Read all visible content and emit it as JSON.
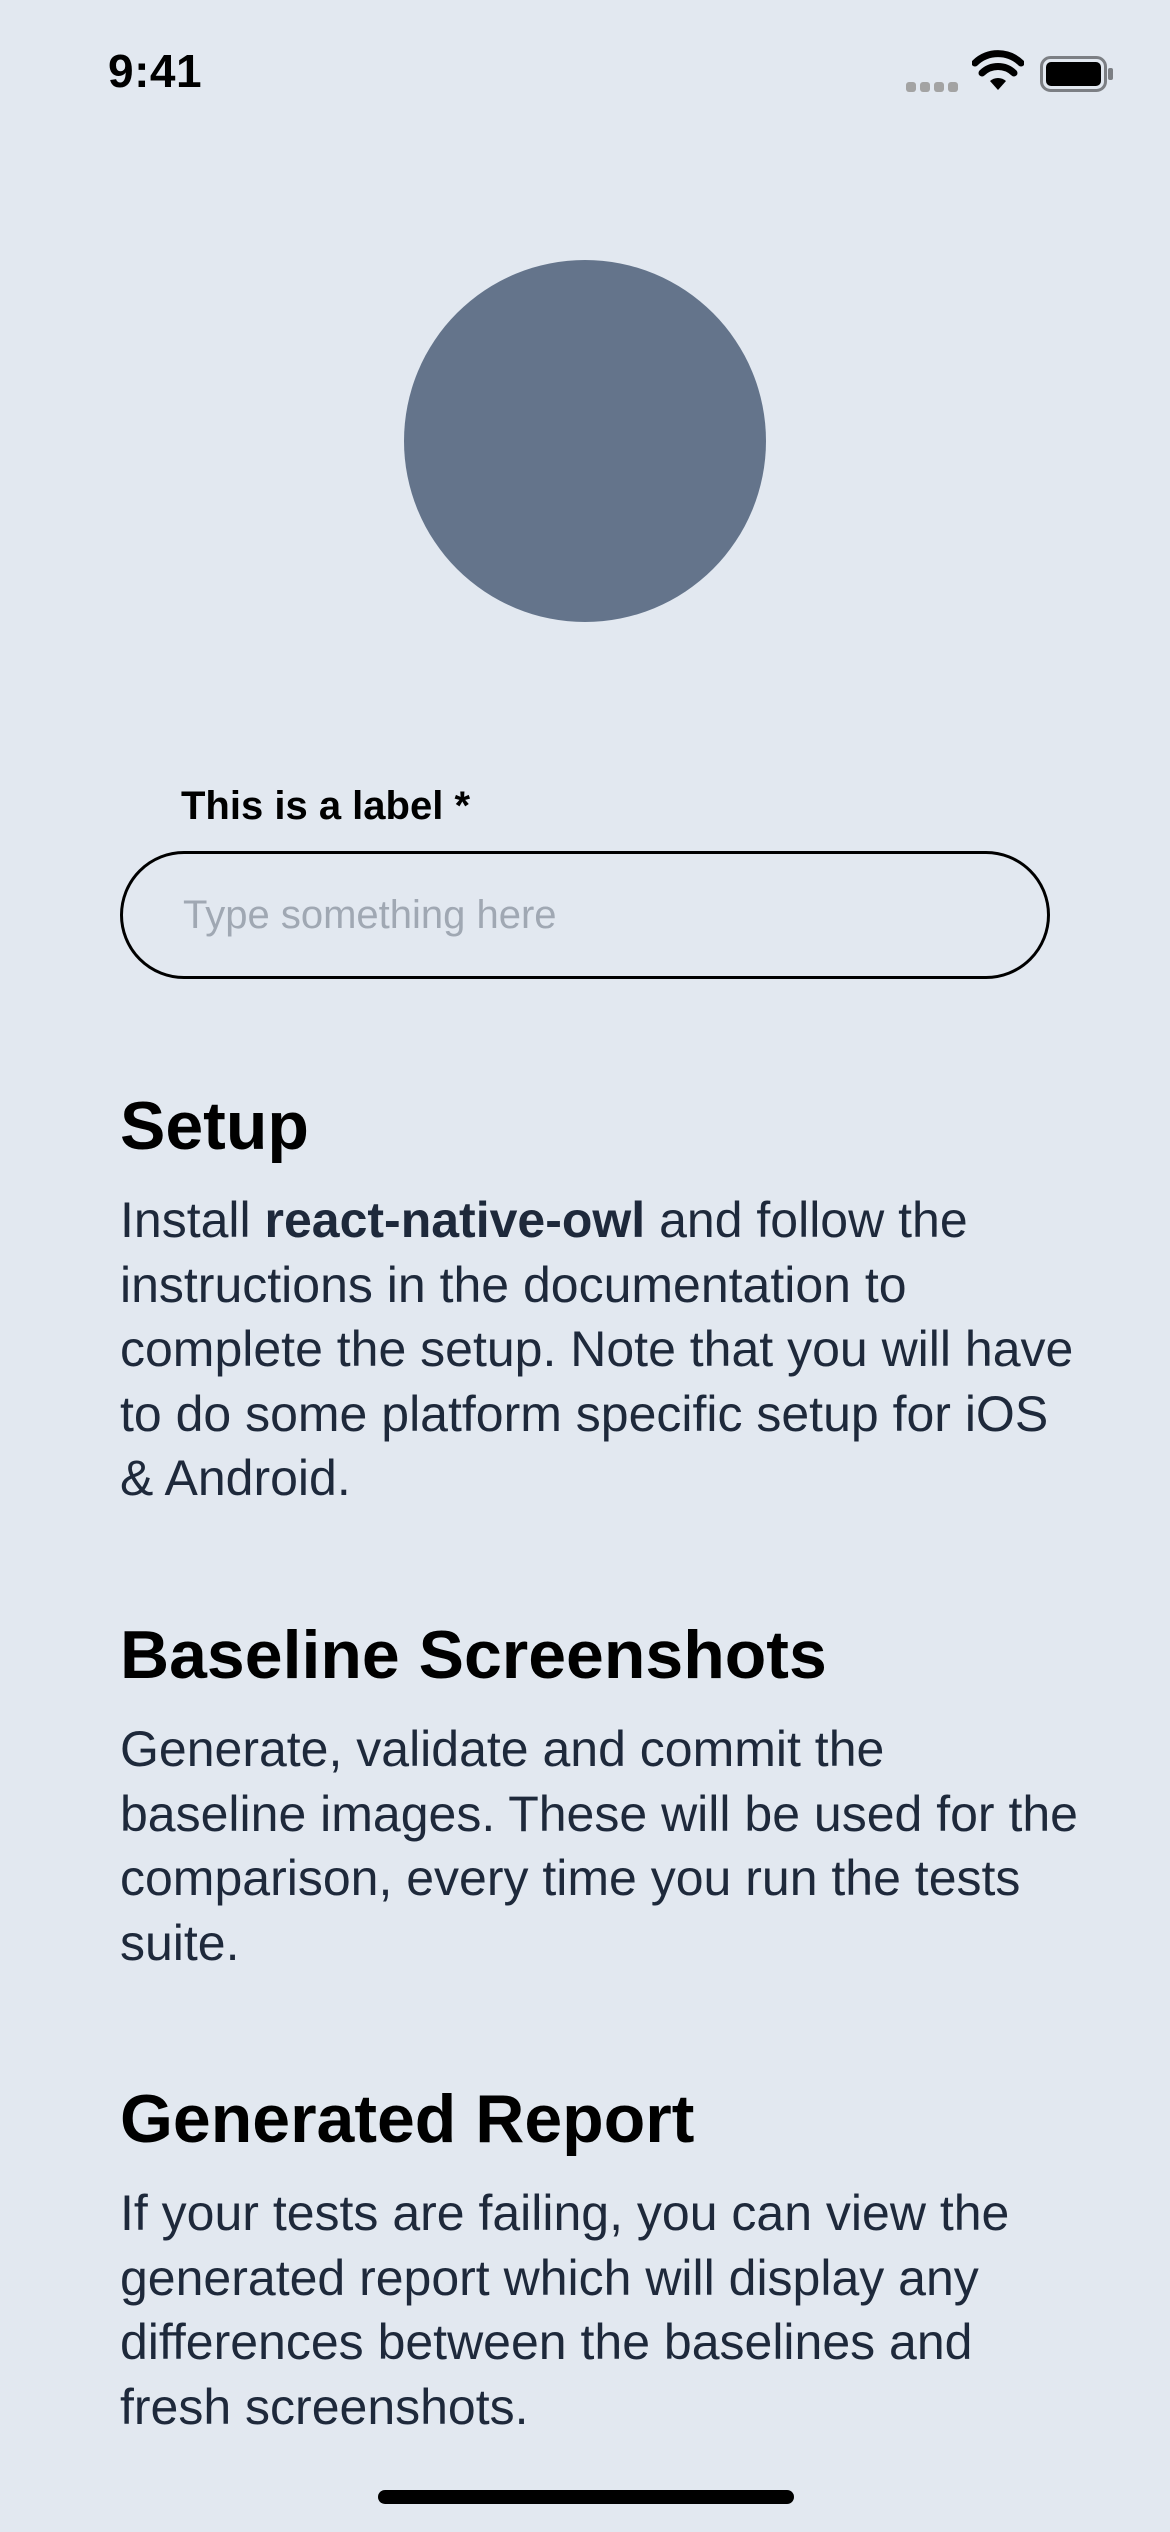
{
  "status_bar": {
    "time": "9:41",
    "signal_icon": "cellular-signal-icon",
    "wifi_icon": "wifi-icon",
    "battery_icon": "battery-icon"
  },
  "avatar": {
    "color": "#64748b"
  },
  "form": {
    "label": "This is a label *",
    "input_placeholder": "Type something here",
    "input_value": ""
  },
  "sections": {
    "setup": {
      "title": "Setup",
      "body_prefix": "Install ",
      "body_bold": "react-native-owl",
      "body_suffix": " and follow the instructions in the documentation to complete the setup. Note that you will have to do some platform specific setup for iOS & Android."
    },
    "baseline": {
      "title": "Baseline Screenshots",
      "body": "Generate, validate and commit the baseline images. These will be used for the comparison, every time you run the tests suite."
    },
    "report": {
      "title": "Generated Report",
      "body": "If your tests are failing, you can view the generated report which will display any differences between the baselines and fresh screenshots."
    }
  },
  "colors": {
    "background": "#e2e8f0",
    "body_text": "#1e293b",
    "avatar": "#64748b"
  }
}
